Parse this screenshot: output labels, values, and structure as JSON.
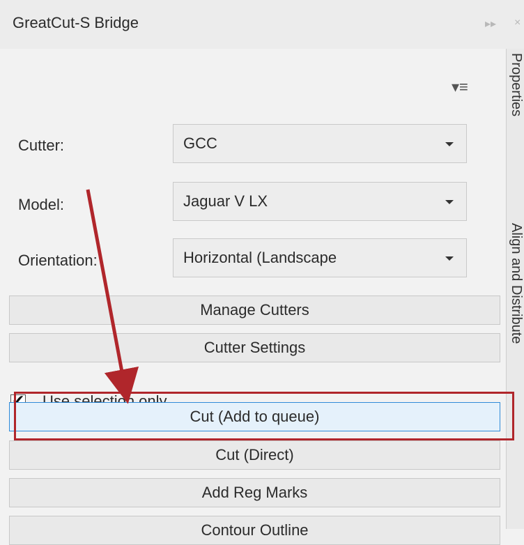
{
  "titlebar": {
    "title": "GreatCut-S Bridge",
    "collapse_icon": "double-chevron-right-icon",
    "close_icon": "close-icon"
  },
  "menu_icon": "dropdown-menu-icon",
  "fields": {
    "cutter": {
      "label": "Cutter:",
      "value": "GCC"
    },
    "model": {
      "label": "Model:",
      "value": "Jaguar V LX"
    },
    "orientation": {
      "label": "Orientation:",
      "value": "Horizontal (Landscape"
    }
  },
  "buttons": {
    "manage_cutters": "Manage Cutters",
    "cutter_settings": "Cutter Settings",
    "cut_add_queue": "Cut (Add to queue)",
    "cut_direct": "Cut (Direct)",
    "add_reg_marks": "Add Reg Marks",
    "contour_outline": "Contour Outline"
  },
  "use_selection": {
    "label": "Use selection only",
    "checked": true
  },
  "side_tabs": {
    "properties": "Properties",
    "align": "Align and Distribute"
  },
  "colors": {
    "accent": "#2f8ad8",
    "annotation": "#b0262b",
    "active_button": "#e5f1fb"
  }
}
